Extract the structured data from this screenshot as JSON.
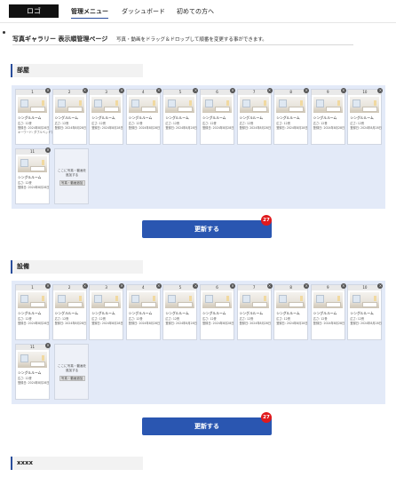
{
  "header": {
    "logo": "ロゴ",
    "nav": [
      {
        "label": "管理メニュー",
        "active": true
      },
      {
        "label": "ダッシュボード",
        "active": false
      },
      {
        "label": "初めての方へ",
        "active": false
      }
    ]
  },
  "page": {
    "title": "写真ギャラリー 表示順管理ページ",
    "description": "写真・動画をドラッグ＆ドロップして順番を変更する事ができます。"
  },
  "sections": [
    {
      "title": "部屋",
      "cards": [
        {
          "num": "1",
          "name": "シングルルーム",
          "meta1": "広さ: 12畳",
          "meta2": "登録日: 2024年8月28日",
          "meta3": "キーワード: ダブルベッドで"
        },
        {
          "num": "2",
          "name": "シングルルーム",
          "meta1": "広さ: 12畳",
          "meta2": "登録日: 2024年8月28日"
        },
        {
          "num": "3",
          "name": "シングルルーム",
          "meta1": "広さ: 12畳",
          "meta2": "登録日: 2024年8月28日"
        },
        {
          "num": "4",
          "name": "シングルルーム",
          "meta1": "広さ: 12畳",
          "meta2": "登録日: 2024年8月28日"
        },
        {
          "num": "5",
          "name": "シングルルーム",
          "meta1": "広さ: 12畳",
          "meta2": "登録日: 2024年8月28日"
        },
        {
          "num": "6",
          "name": "シングルルーム",
          "meta1": "広さ: 12畳",
          "meta2": "登録日: 2024年8月28日"
        },
        {
          "num": "7",
          "name": "シングルルーム",
          "meta1": "広さ: 12畳",
          "meta2": "登録日: 2024年8月28日"
        },
        {
          "num": "8",
          "name": "シングルルーム",
          "meta1": "広さ: 12畳",
          "meta2": "登録日: 2024年8月28日"
        },
        {
          "num": "9",
          "name": "シングルルーム",
          "meta1": "広さ: 12畳",
          "meta2": "登録日: 2024年8月28日"
        },
        {
          "num": "10",
          "name": "シングルルーム",
          "meta1": "広さ: 12畳",
          "meta2": "登録日: 2024年8月28日"
        },
        {
          "num": "11",
          "name": "シングルルーム",
          "meta1": "広さ: 12畳",
          "meta2": "登録日: 2024年8月28日"
        }
      ],
      "add_text": "ここに写真・動画を追加する",
      "add_button": "写真・動画追加",
      "update_button": "更新する",
      "badge": "27"
    },
    {
      "title": "設備",
      "cards": [
        {
          "num": "1",
          "name": "シングルルーム",
          "meta1": "広さ: 12畳",
          "meta2": "登録日: 2024年8月28日"
        },
        {
          "num": "2",
          "name": "シングルルーム",
          "meta1": "広さ: 12畳",
          "meta2": "登録日: 2024年8月28日"
        },
        {
          "num": "3",
          "name": "シングルルーム",
          "meta1": "広さ: 12畳",
          "meta2": "登録日: 2024年8月28日"
        },
        {
          "num": "4",
          "name": "シングルルーム",
          "meta1": "広さ: 12畳",
          "meta2": "登録日: 2024年8月28日"
        },
        {
          "num": "5",
          "name": "シングルルーム",
          "meta1": "広さ: 12畳",
          "meta2": "登録日: 2024年8月28日"
        },
        {
          "num": "6",
          "name": "シングルルーム",
          "meta1": "広さ: 12畳",
          "meta2": "登録日: 2024年8月28日"
        },
        {
          "num": "7",
          "name": "シングルルーム",
          "meta1": "広さ: 12畳",
          "meta2": "登録日: 2024年8月28日"
        },
        {
          "num": "8",
          "name": "シングルルーム",
          "meta1": "広さ: 12畳",
          "meta2": "登録日: 2024年8月28日"
        },
        {
          "num": "9",
          "name": "シングルルーム",
          "meta1": "広さ: 12畳",
          "meta2": "登録日: 2024年8月28日"
        },
        {
          "num": "10",
          "name": "シングルルーム",
          "meta1": "広さ: 12畳",
          "meta2": "登録日: 2024年8月28日"
        },
        {
          "num": "11",
          "name": "シングルルーム",
          "meta1": "広さ: 12畳",
          "meta2": "登録日: 2024年8月28日"
        }
      ],
      "add_text": "ここに写真・動画を追加する",
      "add_button": "写真・動画追加",
      "update_button": "更新する",
      "badge": "27"
    },
    {
      "title": "xxxx",
      "cards": []
    }
  ],
  "colors": {
    "accent": "#2a4e9c",
    "button": "#2a56b1",
    "panel": "#e3eaf8",
    "badge": "#e0191c"
  },
  "icons": {
    "remove": "close-icon",
    "photo": "room-photo-icon"
  }
}
